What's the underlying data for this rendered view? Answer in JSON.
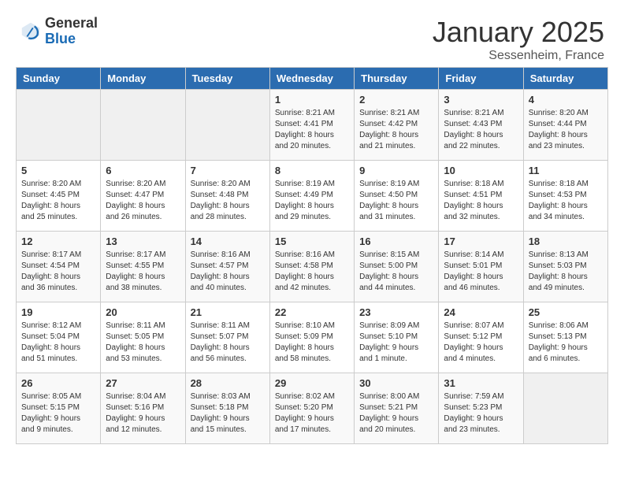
{
  "header": {
    "logo_general": "General",
    "logo_blue": "Blue",
    "month": "January 2025",
    "location": "Sessenheim, France"
  },
  "weekdays": [
    "Sunday",
    "Monday",
    "Tuesday",
    "Wednesday",
    "Thursday",
    "Friday",
    "Saturday"
  ],
  "weeks": [
    [
      {
        "day": "",
        "info": ""
      },
      {
        "day": "",
        "info": ""
      },
      {
        "day": "",
        "info": ""
      },
      {
        "day": "1",
        "info": "Sunrise: 8:21 AM\nSunset: 4:41 PM\nDaylight: 8 hours\nand 20 minutes."
      },
      {
        "day": "2",
        "info": "Sunrise: 8:21 AM\nSunset: 4:42 PM\nDaylight: 8 hours\nand 21 minutes."
      },
      {
        "day": "3",
        "info": "Sunrise: 8:21 AM\nSunset: 4:43 PM\nDaylight: 8 hours\nand 22 minutes."
      },
      {
        "day": "4",
        "info": "Sunrise: 8:20 AM\nSunset: 4:44 PM\nDaylight: 8 hours\nand 23 minutes."
      }
    ],
    [
      {
        "day": "5",
        "info": "Sunrise: 8:20 AM\nSunset: 4:45 PM\nDaylight: 8 hours\nand 25 minutes."
      },
      {
        "day": "6",
        "info": "Sunrise: 8:20 AM\nSunset: 4:47 PM\nDaylight: 8 hours\nand 26 minutes."
      },
      {
        "day": "7",
        "info": "Sunrise: 8:20 AM\nSunset: 4:48 PM\nDaylight: 8 hours\nand 28 minutes."
      },
      {
        "day": "8",
        "info": "Sunrise: 8:19 AM\nSunset: 4:49 PM\nDaylight: 8 hours\nand 29 minutes."
      },
      {
        "day": "9",
        "info": "Sunrise: 8:19 AM\nSunset: 4:50 PM\nDaylight: 8 hours\nand 31 minutes."
      },
      {
        "day": "10",
        "info": "Sunrise: 8:18 AM\nSunset: 4:51 PM\nDaylight: 8 hours\nand 32 minutes."
      },
      {
        "day": "11",
        "info": "Sunrise: 8:18 AM\nSunset: 4:53 PM\nDaylight: 8 hours\nand 34 minutes."
      }
    ],
    [
      {
        "day": "12",
        "info": "Sunrise: 8:17 AM\nSunset: 4:54 PM\nDaylight: 8 hours\nand 36 minutes."
      },
      {
        "day": "13",
        "info": "Sunrise: 8:17 AM\nSunset: 4:55 PM\nDaylight: 8 hours\nand 38 minutes."
      },
      {
        "day": "14",
        "info": "Sunrise: 8:16 AM\nSunset: 4:57 PM\nDaylight: 8 hours\nand 40 minutes."
      },
      {
        "day": "15",
        "info": "Sunrise: 8:16 AM\nSunset: 4:58 PM\nDaylight: 8 hours\nand 42 minutes."
      },
      {
        "day": "16",
        "info": "Sunrise: 8:15 AM\nSunset: 5:00 PM\nDaylight: 8 hours\nand 44 minutes."
      },
      {
        "day": "17",
        "info": "Sunrise: 8:14 AM\nSunset: 5:01 PM\nDaylight: 8 hours\nand 46 minutes."
      },
      {
        "day": "18",
        "info": "Sunrise: 8:13 AM\nSunset: 5:03 PM\nDaylight: 8 hours\nand 49 minutes."
      }
    ],
    [
      {
        "day": "19",
        "info": "Sunrise: 8:12 AM\nSunset: 5:04 PM\nDaylight: 8 hours\nand 51 minutes."
      },
      {
        "day": "20",
        "info": "Sunrise: 8:11 AM\nSunset: 5:05 PM\nDaylight: 8 hours\nand 53 minutes."
      },
      {
        "day": "21",
        "info": "Sunrise: 8:11 AM\nSunset: 5:07 PM\nDaylight: 8 hours\nand 56 minutes."
      },
      {
        "day": "22",
        "info": "Sunrise: 8:10 AM\nSunset: 5:09 PM\nDaylight: 8 hours\nand 58 minutes."
      },
      {
        "day": "23",
        "info": "Sunrise: 8:09 AM\nSunset: 5:10 PM\nDaylight: 9 hours\nand 1 minute."
      },
      {
        "day": "24",
        "info": "Sunrise: 8:07 AM\nSunset: 5:12 PM\nDaylight: 9 hours\nand 4 minutes."
      },
      {
        "day": "25",
        "info": "Sunrise: 8:06 AM\nSunset: 5:13 PM\nDaylight: 9 hours\nand 6 minutes."
      }
    ],
    [
      {
        "day": "26",
        "info": "Sunrise: 8:05 AM\nSunset: 5:15 PM\nDaylight: 9 hours\nand 9 minutes."
      },
      {
        "day": "27",
        "info": "Sunrise: 8:04 AM\nSunset: 5:16 PM\nDaylight: 9 hours\nand 12 minutes."
      },
      {
        "day": "28",
        "info": "Sunrise: 8:03 AM\nSunset: 5:18 PM\nDaylight: 9 hours\nand 15 minutes."
      },
      {
        "day": "29",
        "info": "Sunrise: 8:02 AM\nSunset: 5:20 PM\nDaylight: 9 hours\nand 17 minutes."
      },
      {
        "day": "30",
        "info": "Sunrise: 8:00 AM\nSunset: 5:21 PM\nDaylight: 9 hours\nand 20 minutes."
      },
      {
        "day": "31",
        "info": "Sunrise: 7:59 AM\nSunset: 5:23 PM\nDaylight: 9 hours\nand 23 minutes."
      },
      {
        "day": "",
        "info": ""
      }
    ]
  ]
}
